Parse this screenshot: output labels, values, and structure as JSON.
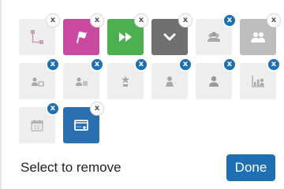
{
  "footer": {
    "status_text": "Select to remove",
    "done_label": "Done"
  },
  "remove_badge_glyph": "x",
  "icons": [
    {
      "name": "flowchart-icon",
      "style": "light",
      "badge": "white"
    },
    {
      "name": "flag-icon",
      "style": "active",
      "color": "#c94a9f",
      "badge": "white"
    },
    {
      "name": "fast-forward-icon",
      "style": "active",
      "color": "#4caf50",
      "badge": "white"
    },
    {
      "name": "chevron-down-icon",
      "style": "active",
      "color": "#707070",
      "badge": "white"
    },
    {
      "name": "team-icon",
      "style": "light",
      "badge": "blue"
    },
    {
      "name": "users-icon",
      "style": "active",
      "color": "#bdbdbd",
      "badge": "white"
    },
    {
      "name": "user-card-icon",
      "style": "light",
      "badge": "blue"
    },
    {
      "name": "user-card-alt-icon",
      "style": "light",
      "badge": "blue"
    },
    {
      "name": "star-user-icon",
      "style": "light",
      "badge": "blue"
    },
    {
      "name": "person-icon",
      "style": "light",
      "badge": "blue"
    },
    {
      "name": "person-solid-icon",
      "style": "light",
      "badge": "blue"
    },
    {
      "name": "user-chart-icon",
      "style": "light",
      "badge": "blue"
    },
    {
      "name": "calendar-icon",
      "style": "light",
      "badge": "blue"
    },
    {
      "name": "window-dots-icon",
      "style": "active",
      "color": "#2a6fb0",
      "badge": "white"
    }
  ]
}
